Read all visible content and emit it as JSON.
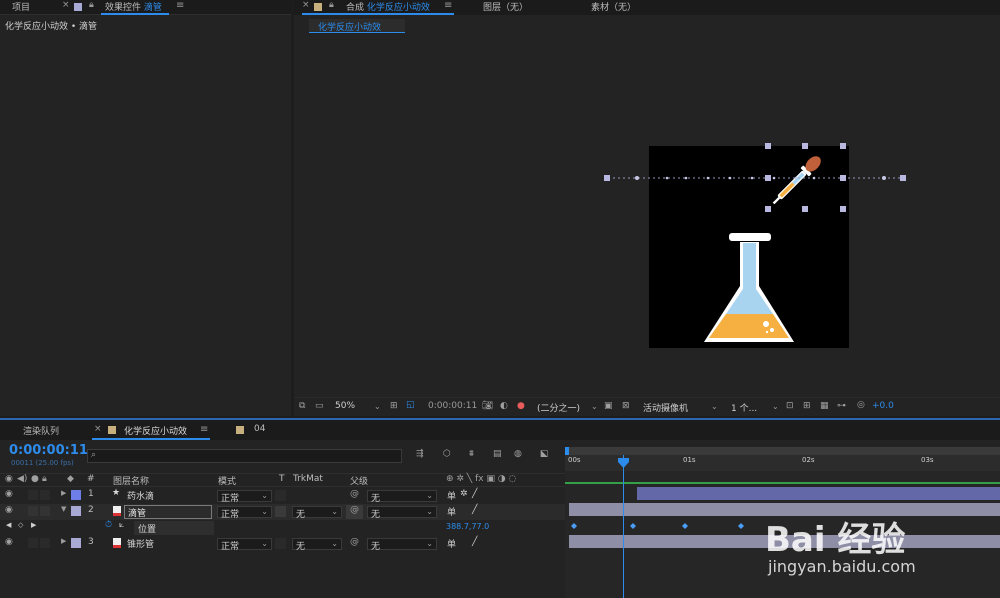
{
  "left_panel": {
    "tab_project": "项目",
    "tab_effect_prefix": "效果控件",
    "tab_effect_layer": "滴管",
    "breadcrumb": "化学反应小动效 • 滴管"
  },
  "right_panel": {
    "tab_comp_prefix": "合成",
    "tab_comp_name": "化学反应小动效",
    "tab_layer": "图层（无）",
    "tab_footage": "素材（无）",
    "comp_subtab": "化学反应小动效"
  },
  "viewer_toolbar": {
    "zoom": "50%",
    "timecode": "0:00:00:11",
    "resolution": "(二分之一)",
    "camera": "活动摄像机",
    "views": "1 个...",
    "exposure": "+0.0"
  },
  "bottom_tabs": {
    "render_queue": "渲染队列",
    "comp": "化学反应小动效",
    "other": "04"
  },
  "timeline": {
    "timecode": "0:00:00:11",
    "fps": "00011 (25.00 fps)",
    "search_placeholder": "",
    "col_num": "#",
    "col_name": "图层名称",
    "col_mode": "模式",
    "col_t": "T",
    "col_trkmat": "TrkMat",
    "col_parent": "父级",
    "ruler": [
      "00s",
      "01s",
      "02s",
      "03s"
    ],
    "layers": [
      {
        "num": "1",
        "name": "药水滴",
        "mode": "正常",
        "trkmat": "",
        "parent": "无",
        "color": "#6e7ee8"
      },
      {
        "num": "2",
        "name": "滴管",
        "mode": "正常",
        "trkmat": "无",
        "parent": "无",
        "color": "#a9a9d6"
      },
      {
        "num": "3",
        "name": "锥形管",
        "mode": "正常",
        "trkmat": "无",
        "parent": "无",
        "color": "#a9a9d6"
      }
    ],
    "property_label": "位置",
    "property_value": "388.7,77.0"
  },
  "watermark": {
    "brand": "Bai 经验",
    "url": "jingyan.baidu.com"
  },
  "colors": {
    "accent": "#2d8ceb",
    "flask_liquid": "#f5b041",
    "flask_glass": "#a8d4f0",
    "bar_purple": "#6268a8",
    "bar_gray": "#8e8ea6"
  }
}
